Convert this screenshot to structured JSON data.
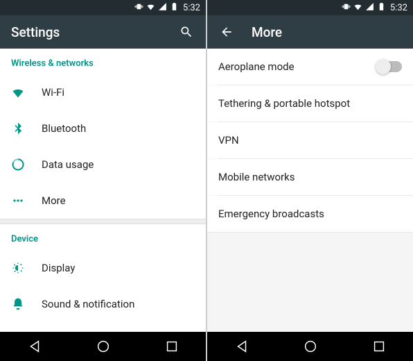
{
  "left": {
    "statusbar": {
      "time": "5:32"
    },
    "appbar": {
      "title": "Settings"
    },
    "sections": {
      "wireless": {
        "header": "Wireless & networks",
        "wifi": "Wi-Fi",
        "bluetooth": "Bluetooth",
        "data_usage": "Data usage",
        "more": "More"
      },
      "device": {
        "header": "Device",
        "display": "Display",
        "sound": "Sound & notification"
      }
    }
  },
  "right": {
    "statusbar": {
      "time": "5:32"
    },
    "appbar": {
      "title": "More"
    },
    "items": {
      "aeroplane": "Aeroplane mode",
      "tethering": "Tethering & portable hotspot",
      "vpn": "VPN",
      "mobile_networks": "Mobile networks",
      "emergency": "Emergency broadcasts"
    }
  }
}
